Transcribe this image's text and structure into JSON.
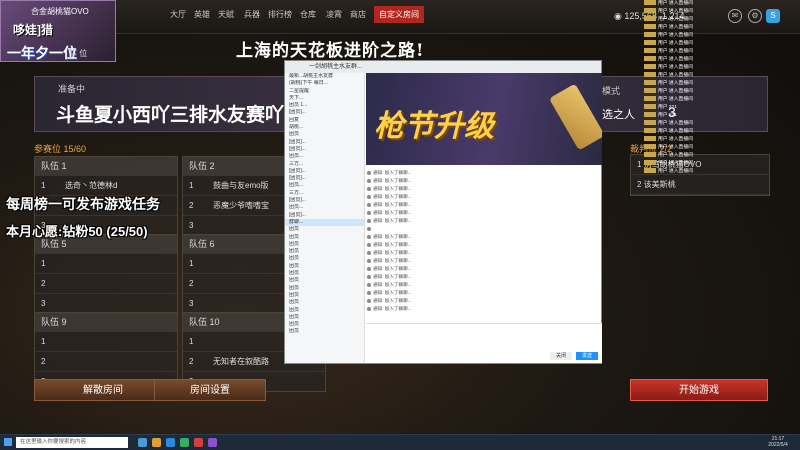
{
  "streamer": {
    "name_line": "合金胡桃猫OVO",
    "tag_line": "哆娃]猎",
    "big_line": "一年夕一位",
    "small_line": "车 位"
  },
  "slogan": "上海的天花板进阶之路!",
  "nav": {
    "tabs": [
      "大厅",
      "英雄",
      "天赋",
      "兵器",
      "排行榜",
      "仓库",
      "凌霄",
      "商店",
      "自定义房间"
    ],
    "active": "自定义房间",
    "currency": "125,568",
    "currency2": "1,214"
  },
  "room": {
    "status": "准备中",
    "name": "斗鱼夏小西吖三排水友赛吖",
    "mode_label": "模式",
    "mode_value": "选之人",
    "mode_num": "3"
  },
  "spectator": {
    "label": "参赛位",
    "count": "15/60"
  },
  "referee": {
    "label": "裁判位",
    "count": "2/2",
    "rows": [
      "1  别笃胡桃猫OVO",
      "2  该美斯桃"
    ]
  },
  "teams": [
    {
      "title": "队伍 1",
      "members": [
        "选奇丶范德林d",
        "",
        ""
      ]
    },
    {
      "title": "队伍 2",
      "members": [
        "鼓曲与友emo版",
        "恶魔少爷嗜嗜宝",
        ""
      ]
    },
    {
      "title": "队伍 5",
      "members": [
        "",
        "",
        ""
      ]
    },
    {
      "title": "队伍 6",
      "members": [
        "",
        "",
        ""
      ]
    },
    {
      "title": "队伍 9",
      "members": [
        "",
        "",
        ""
      ]
    },
    {
      "title": "队伍 10",
      "members": [
        "",
        "无知者在叙酷路",
        ""
      ]
    }
  ],
  "overlay": {
    "weekly": "每周榜一可发布游戏任务",
    "wish": "本月心愿:钻粉50 (25/50)"
  },
  "buttons": {
    "dissolve": "解散房间",
    "settings": "房间设置",
    "start": "开始游戏"
  },
  "chat_window": {
    "title": "一剑胡桃主水友群...",
    "promo_text": "枪节升级",
    "send": "发送",
    "close": "关闭",
    "sidebar": [
      "最新...胡桃主水友群",
      "(胡桃)下午 每日...",
      "二星提醒",
      "天下...",
      "团员 1...",
      "[团员]...",
      "回复",
      "胡桃...",
      "团员",
      "[团员]...",
      "[团员]...",
      "团员...",
      "三方...",
      "[团员]...",
      "[团员]...",
      "团员...",
      "三方...",
      "[团员]...",
      "团员...",
      "[团员]...",
      "群聊...",
      "团员",
      "团员",
      "团员",
      "团员",
      "团员",
      "团员",
      "团员",
      "团员",
      "团员",
      "团员",
      "团员",
      "团员",
      "团员",
      "团员",
      "团员"
    ],
    "log": [
      "通知: 加入了群聊...",
      "通知: 加入了群聊...",
      "通知: 加入了群聊...",
      "通知: 加入了群聊...",
      "通知: 加入了群聊...",
      "通知: 加入了群聊...",
      "通知: 加入了群聊...",
      "",
      "通知: 加入了群聊...",
      "通知: 加入了群聊...",
      "通知: 加入了群聊...",
      "通知: 加入了群聊...",
      "通知: 加入了群聊...",
      "通知: 加入了群聊...",
      "通知: 加入了群聊...",
      "通知: 加入了群聊...",
      "通知: 加入了群聊...",
      "通知: 加入了群聊..."
    ]
  },
  "danmaku": [
    "用户 进入直播间",
    "用户 进入直播间",
    "用户 进入直播间",
    "用户 进入直播间",
    "用户 进入直播间",
    "用户 进入直播间",
    "用户 进入直播间",
    "用户 进入直播间",
    "用户 进入直播间",
    "用户 进入直播间",
    "用户 进入直播间",
    "用户 进入直播间",
    "用户 进入直播间",
    "用户 321",
    "用户 321",
    "用户 进入直播间",
    "用户 进入直播间",
    "用户 进入直播间",
    "用户 进入直播间",
    "用户 进入直播间",
    "用户 进入直播间",
    "用户 进入直播间"
  ],
  "taskbar": {
    "search_placeholder": "在这里输入你要搜索的内容",
    "time": "21:17",
    "date": "2022/5/4"
  },
  "colors": {
    "accent": "#b3261e",
    "gold": "#f0a53a",
    "start": "#c8342a"
  }
}
